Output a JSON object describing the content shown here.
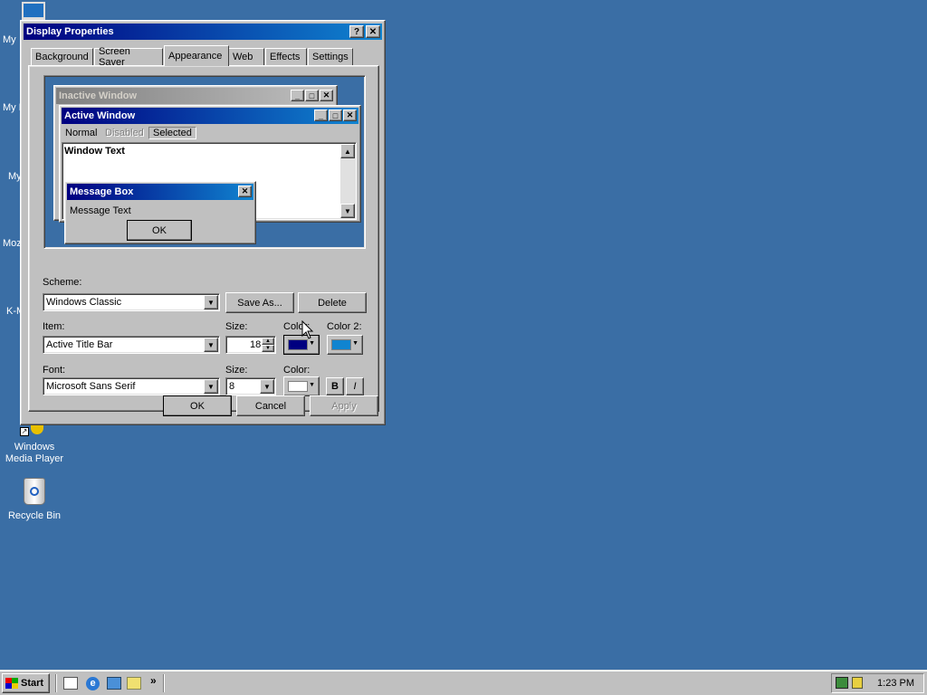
{
  "desktop": {
    "partials": [
      "My",
      "My D",
      "My",
      "Moz",
      "K-M"
    ],
    "wmp_label": "Windows\nMedia Player",
    "recycle_label": "Recycle Bin"
  },
  "dialog": {
    "title": "Display Properties",
    "help_glyph": "?",
    "close_glyph": "✕",
    "tabs": [
      "Background",
      "Screen Saver",
      "Appearance",
      "Web",
      "Effects",
      "Settings"
    ],
    "active_tab": "Appearance",
    "preview": {
      "inactive_title": "Inactive Window",
      "active_title": "Active Window",
      "menu_normal": "Normal",
      "menu_disabled": "Disabled",
      "menu_selected": "Selected",
      "window_text": "Window Text",
      "msgbox_title": "Message Box",
      "msgbox_text": "Message Text",
      "msgbox_ok": "OK"
    },
    "scheme_label": "Scheme:",
    "scheme_value": "Windows Classic",
    "save_as": "Save As...",
    "delete": "Delete",
    "item_label": "Item:",
    "item_value": "Active Title Bar",
    "size_label": "Size:",
    "size_value": "18",
    "color_label": "Color:",
    "color2_label": "Color 2:",
    "font_label": "Font:",
    "font_value": "Microsoft Sans Serif",
    "font_size_label": "Size:",
    "font_size_value": "8",
    "font_color_label": "Color:",
    "bold": "B",
    "italic": "I",
    "ok": "OK",
    "cancel": "Cancel",
    "apply": "Apply"
  },
  "colors": {
    "desktop": "#3a6ea5",
    "title_start": "#000080",
    "title_end": "#1084d0",
    "item_color1": "#000080",
    "item_color2": "#1084d0",
    "font_color": "#ffffff"
  },
  "taskbar": {
    "start": "Start",
    "clock": "1:23 PM",
    "chevron": "»"
  }
}
